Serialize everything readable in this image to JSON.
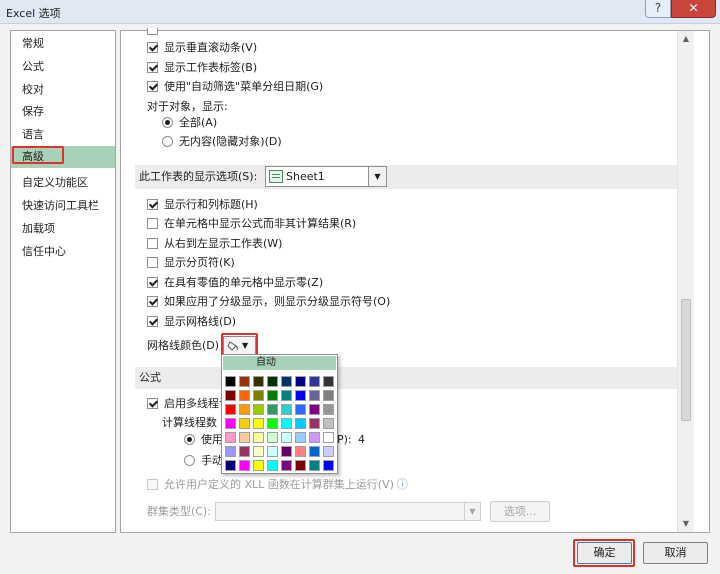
{
  "window": {
    "title": "Excel 选项",
    "help_glyph": "?",
    "close_glyph": "✕"
  },
  "nav": {
    "items": [
      {
        "label": "常规"
      },
      {
        "label": "公式"
      },
      {
        "label": "校对"
      },
      {
        "label": "保存"
      },
      {
        "label": "语言"
      },
      {
        "label": "高级",
        "selected": true
      },
      {
        "label": "自定义功能区"
      },
      {
        "label": "快速访问工具栏"
      },
      {
        "label": "加载项"
      },
      {
        "label": "信任中心"
      }
    ]
  },
  "workbook_options": {
    "show_vertical_scrollbar": {
      "label": "显示垂直滚动条(V)",
      "checked": true
    },
    "show_sheet_tabs": {
      "label": "显示工作表标签(B)",
      "checked": true
    },
    "group_dates": {
      "label": "使用\"自动筛选\"菜单分组日期(G)",
      "checked": true
    },
    "objects_label": "对于对象，显示:",
    "radio_all": {
      "label": "全部(A)",
      "checked": true
    },
    "radio_none": {
      "label": "无内容(隐藏对象)(D)",
      "checked": false
    }
  },
  "sheet_section": {
    "header": "此工作表的显示选项(S):",
    "selected_sheet": "Sheet1",
    "options": [
      {
        "label": "显示行和列标题(H)",
        "checked": true
      },
      {
        "label": "在单元格中显示公式而非其计算结果(R)",
        "checked": false
      },
      {
        "label": "从右到左显示工作表(W)",
        "checked": false
      },
      {
        "label": "显示分页符(K)",
        "checked": false
      },
      {
        "label": "在具有零值的单元格中显示零(Z)",
        "checked": true
      },
      {
        "label": "如果应用了分级显示，则显示分级显示符号(O)",
        "checked": true
      },
      {
        "label": "显示网格线(D)",
        "checked": true
      }
    ],
    "gridline_color_label": "网格线颜色(D)"
  },
  "color_palette": {
    "auto_label": "自动",
    "colors": [
      "#000000",
      "#993300",
      "#333300",
      "#003300",
      "#003366",
      "#000080",
      "#333399",
      "#333333",
      "#800000",
      "#ff6600",
      "#808000",
      "#008000",
      "#008080",
      "#0000ff",
      "#666699",
      "#808080",
      "#ff0000",
      "#ff9900",
      "#99cc00",
      "#339966",
      "#33cccc",
      "#3366ff",
      "#800080",
      "#969696",
      "#ff00ff",
      "#ffcc00",
      "#ffff00",
      "#00ff00",
      "#00ffff",
      "#00ccff",
      "#993366",
      "#c0c0c0",
      "#ff99cc",
      "#ffcc99",
      "#ffff99",
      "#ccffcc",
      "#ccffff",
      "#99ccff",
      "#cc99ff",
      "#ffffff",
      "#9999ff",
      "#993366",
      "#ffffcc",
      "#ccffff",
      "#660066",
      "#ff8080",
      "#0066cc",
      "#ccccff",
      "#000080",
      "#ff00ff",
      "#ffff00",
      "#00ffff",
      "#800080",
      "#800000",
      "#008080",
      "#0000ff"
    ]
  },
  "formula_section": {
    "header": "公式",
    "multithread": {
      "label": "启用多线程计",
      "checked": true
    },
    "threads_label": "计算线程数",
    "radio_use": {
      "label": "使用",
      "checked": true
    },
    "processor_suffix": "P):",
    "processor_count": "4",
    "radio_manual": {
      "label": "手动",
      "checked": false
    },
    "xll_option": {
      "label": "允许用户定义的 XLL 函数在计算群集上运行(V)",
      "checked": false,
      "info_glyph": "ⓘ"
    },
    "cluster_label": "群集类型(C):",
    "options_button": "选项..."
  },
  "footer": {
    "ok_label": "确定",
    "cancel_label": "取消"
  },
  "colors": {
    "selection_green": "#a8d1b9",
    "highlight_red": "#e0302b"
  }
}
